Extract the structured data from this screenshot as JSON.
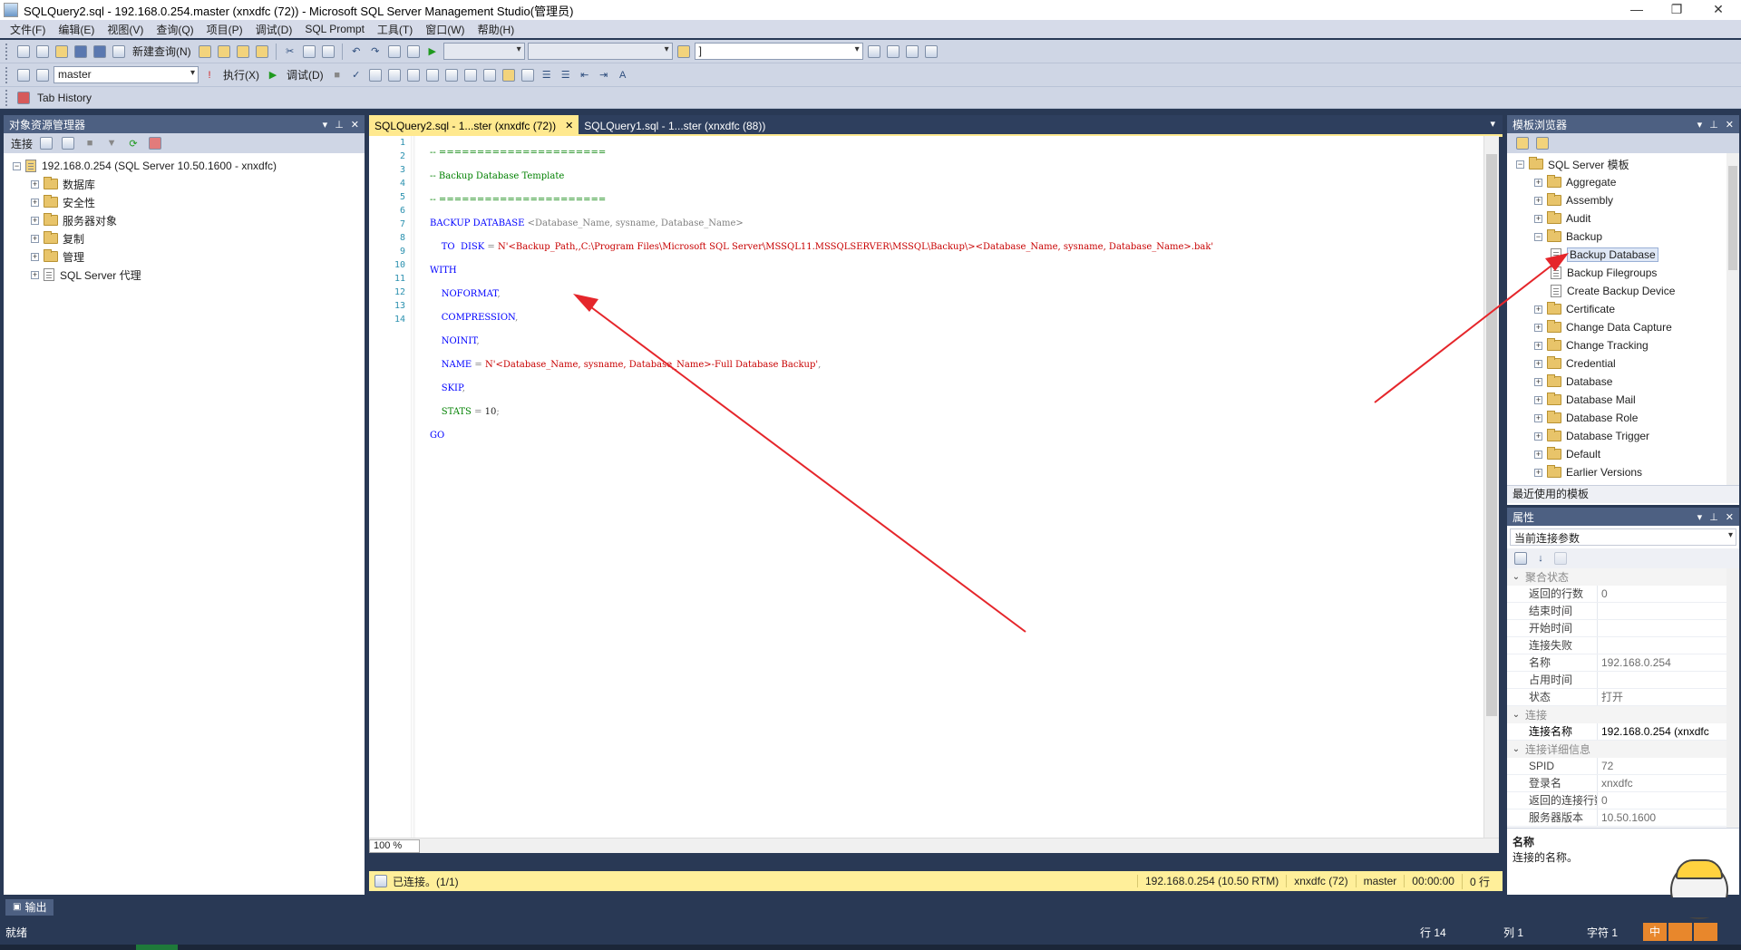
{
  "window": {
    "title": "SQLQuery2.sql - 192.168.0.254.master (xnxdfc (72)) - Microsoft SQL Server Management Studio(管理员)",
    "min": "—",
    "max": "❐",
    "close": "✕"
  },
  "menu": [
    "文件(F)",
    "编辑(E)",
    "视图(V)",
    "查询(Q)",
    "项目(P)",
    "调试(D)",
    "SQL Prompt",
    "工具(T)",
    "窗口(W)",
    "帮助(H)"
  ],
  "toolbar1": {
    "new_query": "新建查询(N)",
    "search_combo": "]"
  },
  "toolbar2": {
    "database": "master",
    "execute": "执行(X)",
    "debug": "调试(D)"
  },
  "toolbar3": {
    "tab_history": "Tab History"
  },
  "object_explorer": {
    "title": "对象资源管理器",
    "connect": "连接",
    "server": "192.168.0.254 (SQL Server 10.50.1600 - xnxdfc)",
    "nodes": [
      "数据库",
      "安全性",
      "服务器对象",
      "复制",
      "管理",
      "SQL Server 代理"
    ]
  },
  "tabs": [
    {
      "label": "SQLQuery2.sql - 1...ster (xnxdfc (72))",
      "active": true
    },
    {
      "label": "SQLQuery1.sql - 1...ster (xnxdfc (88))",
      "active": false
    }
  ],
  "editor": {
    "line_numbers": [
      "1",
      "2",
      "3",
      "4",
      "5",
      "6",
      "7",
      "8",
      "9",
      "10",
      "11",
      "12",
      "13",
      "14"
    ],
    "zoom": "100 %"
  },
  "editor_status": {
    "connected": "已连接。(1/1)",
    "server": "192.168.0.254 (10.50 RTM)",
    "user": "xnxdfc (72)",
    "db": "master",
    "time": "00:00:00",
    "rows": "0 行"
  },
  "template_browser": {
    "title": "模板浏览器",
    "root": "SQL Server 模板",
    "items": [
      {
        "label": "Aggregate",
        "type": "folder",
        "level": 1,
        "exp": "+"
      },
      {
        "label": "Assembly",
        "type": "folder",
        "level": 1,
        "exp": "+"
      },
      {
        "label": "Audit",
        "type": "folder",
        "level": 1,
        "exp": "+"
      },
      {
        "label": "Backup",
        "type": "folder",
        "level": 1,
        "exp": "−"
      },
      {
        "label": "Backup Database",
        "type": "doc",
        "level": 2,
        "selected": true
      },
      {
        "label": "Backup Filegroups",
        "type": "doc",
        "level": 2
      },
      {
        "label": "Create Backup Device",
        "type": "doc",
        "level": 2
      },
      {
        "label": "Certificate",
        "type": "folder",
        "level": 1,
        "exp": "+"
      },
      {
        "label": "Change Data Capture",
        "type": "folder",
        "level": 1,
        "exp": "+"
      },
      {
        "label": "Change Tracking",
        "type": "folder",
        "level": 1,
        "exp": "+"
      },
      {
        "label": "Credential",
        "type": "folder",
        "level": 1,
        "exp": "+"
      },
      {
        "label": "Database",
        "type": "folder",
        "level": 1,
        "exp": "+"
      },
      {
        "label": "Database Mail",
        "type": "folder",
        "level": 1,
        "exp": "+"
      },
      {
        "label": "Database Role",
        "type": "folder",
        "level": 1,
        "exp": "+"
      },
      {
        "label": "Database Trigger",
        "type": "folder",
        "level": 1,
        "exp": "+"
      },
      {
        "label": "Default",
        "type": "folder",
        "level": 1,
        "exp": "+"
      },
      {
        "label": "Earlier Versions",
        "type": "folder",
        "level": 1,
        "exp": "+"
      }
    ],
    "recent": "最近使用的模板"
  },
  "properties": {
    "title": "属性",
    "selector": "当前连接参数",
    "groups": [
      {
        "name": "聚合状态",
        "rows": [
          [
            "返回的行数",
            "0"
          ],
          [
            "结束时间",
            ""
          ],
          [
            "开始时间",
            ""
          ],
          [
            "连接失败",
            ""
          ],
          [
            "名称",
            "192.168.0.254"
          ],
          [
            "占用时间",
            ""
          ],
          [
            "状态",
            "打开"
          ]
        ]
      },
      {
        "name": "连接",
        "rows": [
          [
            "连接名称",
            "192.168.0.254 (xnxdfc"
          ]
        ]
      },
      {
        "name": "连接详细信息",
        "rows": [
          [
            "SPID",
            "72"
          ],
          [
            "登录名",
            "xnxdfc"
          ],
          [
            "返回的连接行数",
            "0"
          ],
          [
            "服务器版本",
            "10.50.1600"
          ]
        ]
      }
    ],
    "desc_title": "名称",
    "desc_text": "连接的名称。"
  },
  "output_tab": "输出",
  "statusbar": {
    "ready": "就绪",
    "line": "行 14",
    "col": "列 1",
    "char": "字符 1"
  },
  "ime": {
    "cn": "中"
  },
  "colors": {
    "title_panel": "#4d6082",
    "status_yellow": "#ffef9a",
    "annotation": "#e5262b"
  }
}
